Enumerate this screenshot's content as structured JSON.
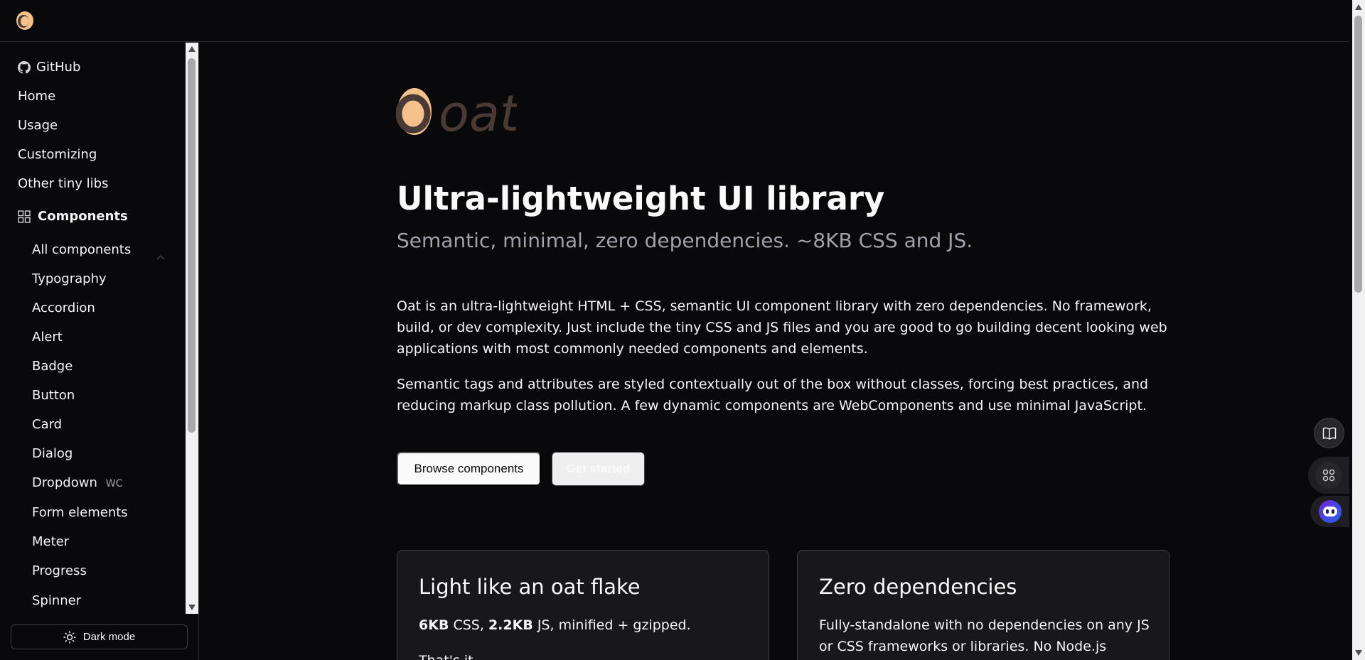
{
  "sidebar": {
    "github": "GitHub",
    "items": [
      "Home",
      "Usage",
      "Customizing",
      "Other tiny libs"
    ],
    "components_label": "Components",
    "sub_items": [
      "All components",
      "Typography",
      "Accordion",
      "Alert",
      "Badge",
      "Button",
      "Card",
      "Dialog",
      "Dropdown",
      "Form elements",
      "Meter",
      "Progress",
      "Spinner"
    ],
    "dropdown_tag": "WC",
    "dark_mode_label": "Dark mode"
  },
  "hero": {
    "logo_text": "oat",
    "title": "Ultra-lightweight UI library",
    "subtitle": "Semantic, minimal, zero dependencies. ~8KB CSS and JS.",
    "para1": "Oat is an ultra-lightweight HTML + CSS, semantic UI component library with zero dependencies. No framework, build, or dev complexity. Just include the tiny CSS and JS files and you are good to go building decent looking web applications with most commonly needed components and elements.",
    "para2": "Semantic tags and attributes are styled contextually out of the box without classes, forcing best practices, and reducing markup class pollution. A few dynamic components are WebComponents and use minimal JavaScript.",
    "browse_label": "Browse components",
    "get_started_label": "Get started"
  },
  "cards": {
    "light": {
      "title": "Light like an oat flake",
      "css_size": "6KB",
      "css_label": " CSS, ",
      "js_size": "2.2KB",
      "js_label": " JS, minified + gzipped.",
      "extra": "That's it."
    },
    "zero": {
      "title": "Zero dependencies",
      "body": "Fully-standalone with no dependencies on any JS or CSS frameworks or libraries. No Node.js ecosystem"
    }
  },
  "colors": {
    "background": "#09090b",
    "card_bg": "#18181b",
    "border": "#3f3f46",
    "muted_text": "#a1a1aa",
    "logo_orange": "#f5c28c",
    "logo_brown": "#4a3a36"
  }
}
